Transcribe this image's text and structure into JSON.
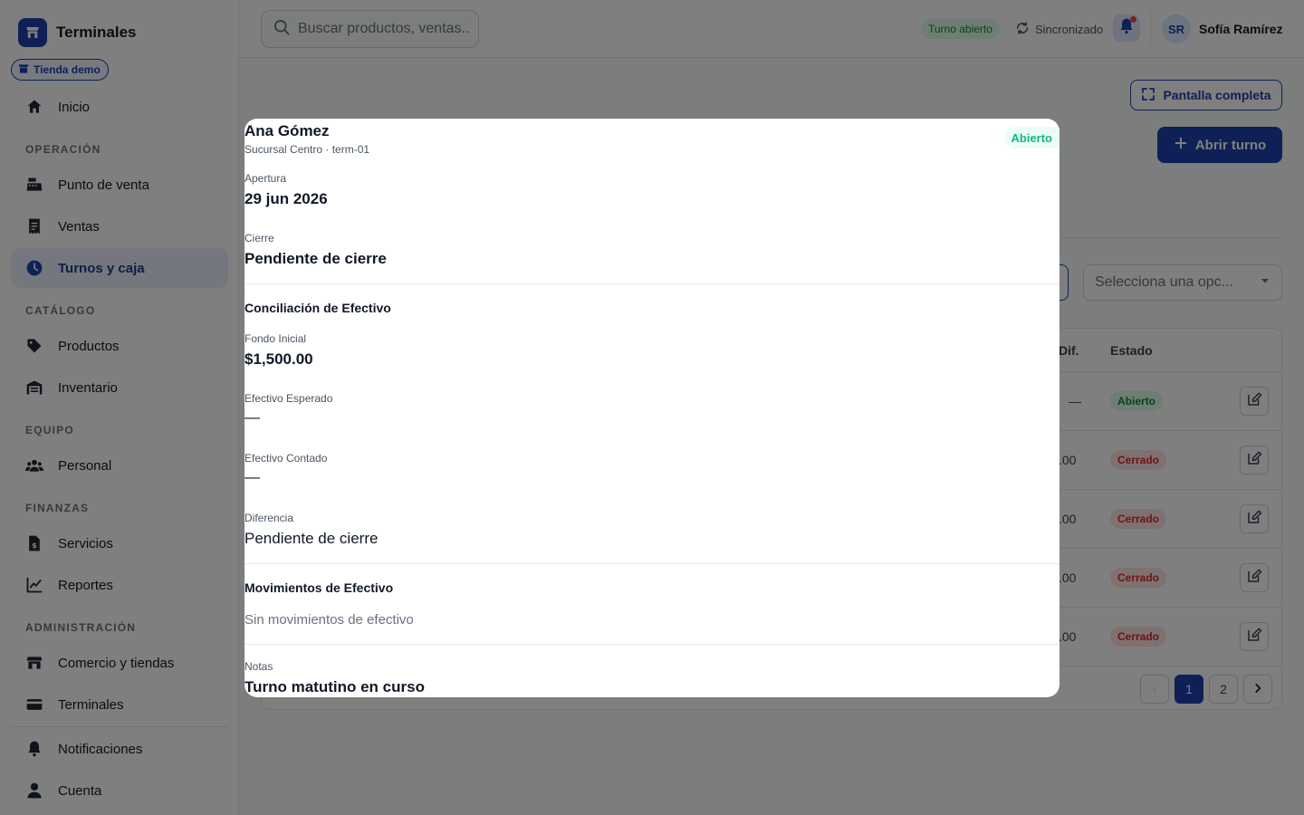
{
  "sidebar": {
    "brand_title": "Terminales",
    "store_chip": "Tienda demo",
    "items": [
      {
        "label": "Inicio"
      },
      {
        "section": "OPERACIÓN"
      },
      {
        "label": "Punto de venta"
      },
      {
        "label": "Ventas"
      },
      {
        "label": "Turnos y caja"
      },
      {
        "section": "CATÁLOGO"
      },
      {
        "label": "Productos"
      },
      {
        "label": "Inventario"
      },
      {
        "section": "EQUIPO"
      },
      {
        "label": "Personal"
      },
      {
        "section": "FINANZAS"
      },
      {
        "label": "Servicios"
      },
      {
        "label": "Reportes"
      },
      {
        "section": "ADMINISTRACIÓN"
      },
      {
        "label": "Comercio y tiendas"
      },
      {
        "label": "Terminales"
      },
      {
        "label": "Notificaciones"
      },
      {
        "label": "Cuenta"
      }
    ]
  },
  "header": {
    "search_placeholder": "Buscar productos, ventas...",
    "shift_status": "Turno abierto",
    "sync_status": "Sincronizado",
    "user_initials": "SR",
    "user_name": "Sofía Ramírez"
  },
  "main": {
    "fullscreen_label": "Pantalla completa",
    "open_shift_label": "Abrir turno",
    "select_placeholder": "Selecciona una opc...",
    "table": {
      "headers": {
        "dif": "Dif.",
        "estado": "Estado"
      },
      "rows": [
        {
          "dif": "—",
          "estado": "Abierto"
        },
        {
          "dif": ".00",
          "estado": "Cerrado"
        },
        {
          "dif": ".00",
          "estado": "Cerrado"
        },
        {
          "dif": ".00",
          "estado": "Cerrado"
        },
        {
          "dif": ".00",
          "estado": "Cerrado"
        }
      ]
    },
    "pagination": {
      "pages": [
        "1",
        "2"
      ],
      "current": "1"
    }
  },
  "modal": {
    "name": "Ana Gómez",
    "subtitle": "Sucursal Centro · term-01",
    "status": "Abierto",
    "apertura_label": "Apertura",
    "apertura_value": "29 jun 2026",
    "cierre_label": "Cierre",
    "cierre_value": "Pendiente de cierre",
    "conciliacion_title": "Conciliación de Efectivo",
    "fondo_label": "Fondo Inicial",
    "fondo_value": "$1,500.00",
    "esperado_label": "Efectivo Esperado",
    "esperado_value": "—",
    "contado_label": "Efectivo Contado",
    "contado_value": "—",
    "diferencia_label": "Diferencia",
    "diferencia_value": "Pendiente de cierre",
    "movimientos_title": "Movimientos de Efectivo",
    "movimientos_empty": "Sin movimientos de efectivo",
    "notas_label": "Notas",
    "notas_value": "Turno matutino en curso"
  },
  "colors": {
    "primary": "#1e40af",
    "open_green": "#15803d",
    "closed_red": "#dc2626",
    "notification_dot": "#ef4444"
  }
}
